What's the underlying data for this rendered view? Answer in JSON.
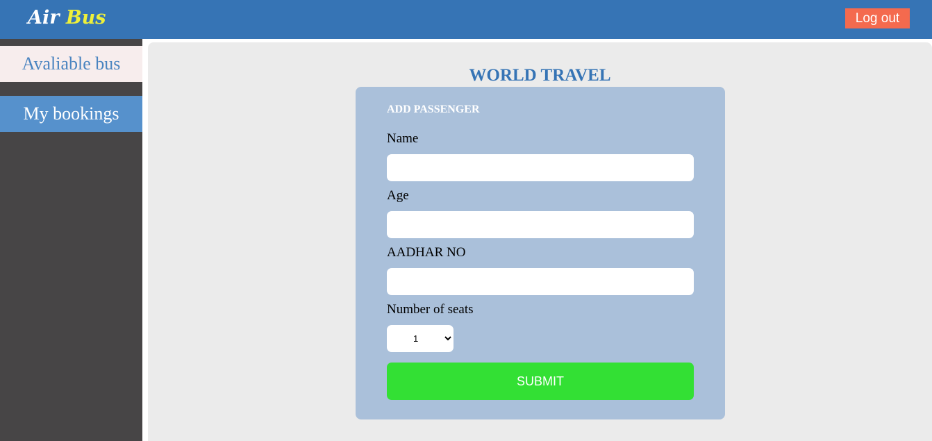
{
  "header": {
    "logo_part1": "Air",
    "logo_part2": "Bus",
    "logout_label": "Log out"
  },
  "sidebar": {
    "items": [
      {
        "label": "Avaliable bus"
      },
      {
        "label": "My bookings"
      }
    ]
  },
  "main": {
    "title": "WORLD TRAVEL",
    "form": {
      "heading": "ADD PASSENGER",
      "name_label": "Name",
      "name_value": "",
      "age_label": "Age",
      "age_value": "",
      "aadhar_label": "AADHAR NO",
      "aadhar_value": "",
      "seats_label": "Number of seats",
      "seats_options": [
        "1"
      ],
      "seats_selected": "1",
      "submit_label": "SUBMIT"
    }
  },
  "colors": {
    "header_bg": "#3674b5",
    "logout_bg": "#f46a4e",
    "sidebar_bg": "#474546",
    "sidebar_active_bg": "#5691cc",
    "form_card_bg": "#aac0da",
    "submit_bg": "#33e034",
    "logo_accent": "#eef03a"
  }
}
